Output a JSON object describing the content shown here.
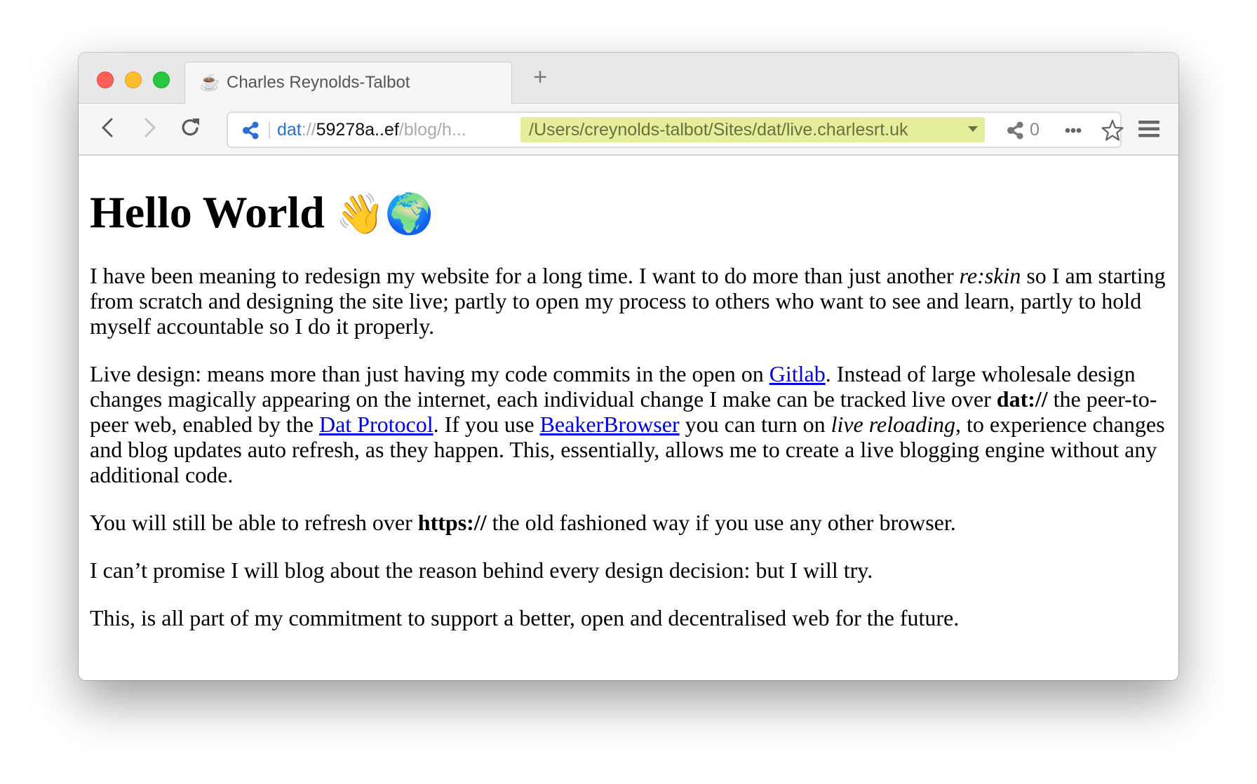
{
  "window": {
    "tab": {
      "favicon": "☕",
      "title": "Charles Reynolds-Talbot"
    },
    "new_tab_label": "+"
  },
  "toolbar": {
    "url": {
      "scheme": "dat",
      "separator": "://",
      "host": "59278a..ef",
      "path": "/blog/h..."
    },
    "local_path": "/Users/creynolds-talbot/Sites/dat/live.charlesrt.uk",
    "peer_count": "0",
    "icons": {
      "back": "back-arrow-icon",
      "forward": "forward-arrow-icon",
      "reload": "reload-icon",
      "site_info": "share-network-icon",
      "peers": "share-network-icon",
      "more": "more-dots-icon",
      "bookmark": "star-icon",
      "menu": "hamburger-menu-icon"
    },
    "colors": {
      "scheme": "#2b6fd6",
      "local_path_bg": "#e6ed9b",
      "local_path_text": "#6c6f40"
    }
  },
  "page": {
    "heading": "Hello World ",
    "heading_emoji": "👋🌍",
    "paragraphs": {
      "p1": {
        "t1": "I have been meaning to redesign my website for a long time. I want to do more than just another ",
        "em1": "re:skin",
        "t2": " so I am starting from scratch and designing the site live; partly to open my process to others who want to see and learn, partly to hold myself accountable so I do it properly."
      },
      "p2": {
        "t1": "Live design: means more than just having my code commits in the open on ",
        "link1": "Gitlab",
        "t2": ". Instead of large wholesale design changes magically appearing on the internet, each individual change I make can be tracked live over ",
        "strong1": "dat://",
        "t3": " the peer-to-peer web, enabled by the ",
        "link2": "Dat Protocol",
        "t4": ". If you use ",
        "link3": "BeakerBrowser",
        "t5": " you can turn on ",
        "em1": "live reloading",
        "t6": ", to experience changes and blog updates auto refresh, as they happen. This, essentially, allows me to create a live blogging engine without any additional code."
      },
      "p3": {
        "t1": "You will still be able to refresh over ",
        "strong1": "https://",
        "t2": " the old fashioned way if you use any other browser."
      },
      "p4": "I can’t promise I will blog about the reason behind every design decision: but I will try.",
      "p5": "This, is all part of my commitment to support a better, open and decentralised web for the future."
    },
    "link_color": "#0000ee"
  }
}
